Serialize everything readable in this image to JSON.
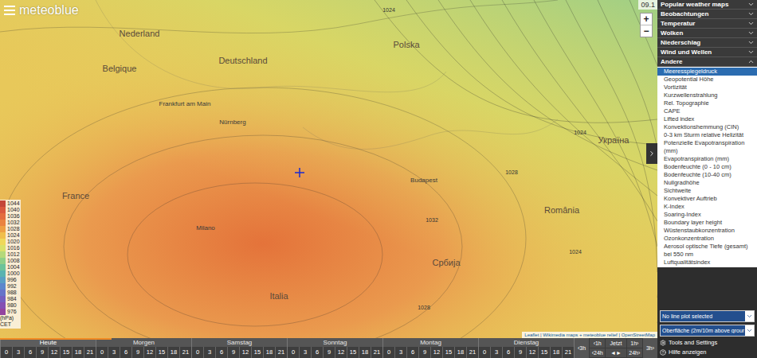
{
  "logo": "meteoblue",
  "date": "09.1",
  "zoom": {
    "in": "+",
    "out": "−"
  },
  "map_labels": [
    "Nederland",
    "Belgique",
    "Deutschland",
    "Polska",
    "Україна",
    "France",
    "România",
    "Србија",
    "Italia",
    "Frankfurt am Main",
    "Nürnberg",
    "Budapest",
    "Milano"
  ],
  "isobar_labels": [
    "1024",
    "1024",
    "1028",
    "1032",
    "1028",
    "1024"
  ],
  "legend": {
    "values": [
      {
        "value": "1044",
        "color": "#c4463a"
      },
      {
        "value": "1040",
        "color": "#d9593f"
      },
      {
        "value": "1036",
        "color": "#e36d3f"
      },
      {
        "value": "1032",
        "color": "#ea8340"
      },
      {
        "value": "1028",
        "color": "#eea044"
      },
      {
        "value": "1024",
        "color": "#f0bf4c"
      },
      {
        "value": "1020",
        "color": "#eed85a"
      },
      {
        "value": "1016",
        "color": "#d9e16a"
      },
      {
        "value": "1012",
        "color": "#b5d97a"
      },
      {
        "value": "1008",
        "color": "#8fcf88"
      },
      {
        "value": "1004",
        "color": "#6cc39a"
      },
      {
        "value": "1000",
        "color": "#5ab3b0"
      },
      {
        "value": "996",
        "color": "#5a9fc4"
      },
      {
        "value": "992",
        "color": "#5d88cc"
      },
      {
        "value": "988",
        "color": "#6673c9"
      },
      {
        "value": "984",
        "color": "#745fc0"
      },
      {
        "value": "980",
        "color": "#8450b3"
      },
      {
        "value": "976",
        "color": "#93449f"
      }
    ],
    "unit": "(hPa)",
    "timezone": "CET"
  },
  "attribution": "Leaflet | Wikimedia maps + meteoblue relief | OpenStreetMap",
  "sidebar": {
    "sections": [
      {
        "label": "Popular weather maps",
        "expanded": false
      },
      {
        "label": "Beobachtungen",
        "expanded": false
      },
      {
        "label": "Temperatur",
        "expanded": false
      },
      {
        "label": "Wolken",
        "expanded": false
      },
      {
        "label": "Niederschlag",
        "expanded": false
      },
      {
        "label": "Wind und Wellen",
        "expanded": false
      },
      {
        "label": "Andere",
        "expanded": true
      }
    ],
    "items": [
      {
        "label": "Meeresspiegeldruck",
        "selected": true
      },
      {
        "label": "Geopotential Höhe",
        "selected": false
      },
      {
        "label": "Vortizität",
        "selected": false
      },
      {
        "label": "Kurzwellenstrahlung",
        "selected": false
      },
      {
        "label": "Rel. Topographie",
        "selected": false
      },
      {
        "label": "CAPE",
        "selected": false
      },
      {
        "label": "Lifted index",
        "selected": false
      },
      {
        "label": "Konvektionshemmung (CIN)",
        "selected": false
      },
      {
        "label": "0-3 km Sturm relative Helizität",
        "selected": false
      },
      {
        "label": "Potenzielle Evapotranspiration (mm)",
        "selected": false
      },
      {
        "label": "Evapotranspiration (mm)",
        "selected": false
      },
      {
        "label": "Bodenfeuchte (0 - 10 cm)",
        "selected": false
      },
      {
        "label": "Bodenfeuchte (10-40 cm)",
        "selected": false
      },
      {
        "label": "Nullgradhöhe",
        "selected": false
      },
      {
        "label": "Sichtweite",
        "selected": false
      },
      {
        "label": "Konvektiver Auftrieb",
        "selected": false
      },
      {
        "label": "K-Index",
        "selected": false
      },
      {
        "label": "Soaring-Index",
        "selected": false
      },
      {
        "label": "Boundary layer height",
        "selected": false
      },
      {
        "label": "Wüstenstaubkonzentration",
        "selected": false
      },
      {
        "label": "Ozonkonzentration",
        "selected": false
      },
      {
        "label": "Aerosol optische Tiefe (gesamt) bei 550 nm",
        "selected": false
      },
      {
        "label": "Luftqualitätsindex",
        "selected": false
      }
    ],
    "line_plot_select": "No line plot selected",
    "level_select": "Oberfläche (2m/10m above grour",
    "tools": "Tools and Settings",
    "help": "Hilfe anzeigen"
  },
  "timeline": {
    "level": 0.17,
    "days": [
      {
        "label": "Heute",
        "selected": true,
        "hours": [
          "0",
          "3",
          "6",
          "9",
          "12",
          "15",
          "18",
          "21"
        ]
      },
      {
        "label": "Morgen",
        "selected": false,
        "hours": [
          "0",
          "3",
          "6",
          "9",
          "12",
          "15",
          "18",
          "21"
        ]
      },
      {
        "label": "Samstag",
        "selected": false,
        "hours": [
          "0",
          "3",
          "6",
          "9",
          "12",
          "15",
          "18",
          "21"
        ]
      },
      {
        "label": "Sonntag",
        "selected": false,
        "hours": [
          "0",
          "3",
          "6",
          "9",
          "12",
          "15",
          "18",
          "21"
        ]
      },
      {
        "label": "Montag",
        "selected": false,
        "hours": [
          "0",
          "3",
          "6",
          "9",
          "12",
          "15",
          "18",
          "21"
        ]
      },
      {
        "label": "Dienstag",
        "selected": false,
        "hours": [
          "0",
          "3",
          "6",
          "9",
          "12",
          "15",
          "18",
          "21"
        ]
      }
    ],
    "controls": {
      "back_3h": "‹3h",
      "back_1h": "‹1h",
      "now": "Jetzt",
      "fwd_1h": "1h›",
      "back_24h": "‹24h",
      "play": "◄►",
      "fwd_24h": "24h›",
      "fwd_3h": "3h›"
    }
  }
}
